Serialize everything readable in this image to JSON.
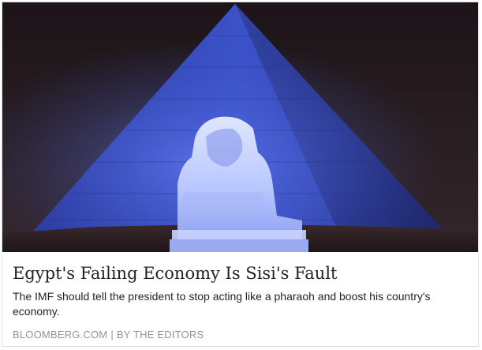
{
  "link_preview": {
    "title": "Egypt's Failing Economy Is Sisi's Fault",
    "description": "The IMF should tell the president to stop acting like a pharaoh and boost his country's economy.",
    "domain": "BLOOMBERG.COM",
    "separator": "|",
    "byline": "BY THE EDITORS"
  },
  "colors": {
    "title_text": "#1d2129",
    "meta_text": "#90949c",
    "border": "#dddfe2",
    "night_sky": "#2a1e22",
    "pyramid_light": "#3a4fc8"
  }
}
